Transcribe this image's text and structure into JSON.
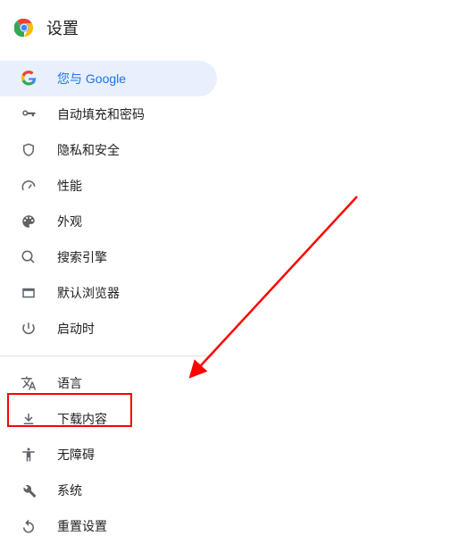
{
  "header": {
    "title": "设置"
  },
  "nav": {
    "group1": [
      {
        "label": "您与 Google",
        "icon": "google"
      },
      {
        "label": "自动填充和密码",
        "icon": "key"
      },
      {
        "label": "隐私和安全",
        "icon": "shield"
      },
      {
        "label": "性能",
        "icon": "speed"
      },
      {
        "label": "外观",
        "icon": "palette"
      },
      {
        "label": "搜索引擎",
        "icon": "search"
      },
      {
        "label": "默认浏览器",
        "icon": "browser"
      },
      {
        "label": "启动时",
        "icon": "power"
      }
    ],
    "group2": [
      {
        "label": "语言",
        "icon": "translate"
      },
      {
        "label": "下载内容",
        "icon": "download"
      },
      {
        "label": "无障碍",
        "icon": "accessibility"
      },
      {
        "label": "系统",
        "icon": "wrench"
      },
      {
        "label": "重置设置",
        "icon": "reset"
      }
    ]
  },
  "annotation": {
    "highlight_target": "下载内容",
    "arrow_color": "#ff0000"
  }
}
